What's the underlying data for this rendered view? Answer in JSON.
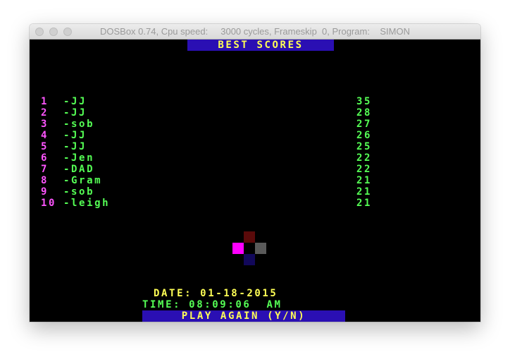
{
  "window": {
    "title": "DOSBox 0.74, Cpu speed:     3000 cycles, Frameskip  0, Program:    SIMON"
  },
  "game": {
    "header": "BEST SCORES",
    "scores": [
      {
        "rank": "1",
        "name": "-JJ",
        "score": "35"
      },
      {
        "rank": "2",
        "name": "-JJ",
        "score": "28"
      },
      {
        "rank": "3",
        "name": "-sob",
        "score": "27"
      },
      {
        "rank": "4",
        "name": "-JJ",
        "score": "26"
      },
      {
        "rank": "5",
        "name": "-JJ",
        "score": "25"
      },
      {
        "rank": "6",
        "name": "-Jen",
        "score": "22"
      },
      {
        "rank": "7",
        "name": "-DAD",
        "score": "22"
      },
      {
        "rank": "8",
        "name": "-Gram",
        "score": "21"
      },
      {
        "rank": "9",
        "name": "-sob",
        "score": "21"
      },
      {
        "rank": "10",
        "name": "-leigh",
        "score": "21"
      }
    ],
    "date_line": "DATE: 01-18-2015",
    "time_line": "TIME: 08:09:06  AM",
    "prompt": "PLAY AGAIN (Y/N)",
    "colors": {
      "background": "#000000",
      "header_bar": "#2a0fb3",
      "header_text": "#ffff55",
      "rank_text": "#ff55ff",
      "name_text": "#55ff55",
      "score_text": "#55ff55",
      "date_text": "#ffff55",
      "time_text": "#55ff55",
      "prompt_bar": "#2a0fb3",
      "prompt_text": "#ffff55",
      "pad_top": "#5a0a0a",
      "pad_left": "#ff00ff",
      "pad_right": "#5a5a5a",
      "pad_bottom": "#12085a"
    }
  }
}
